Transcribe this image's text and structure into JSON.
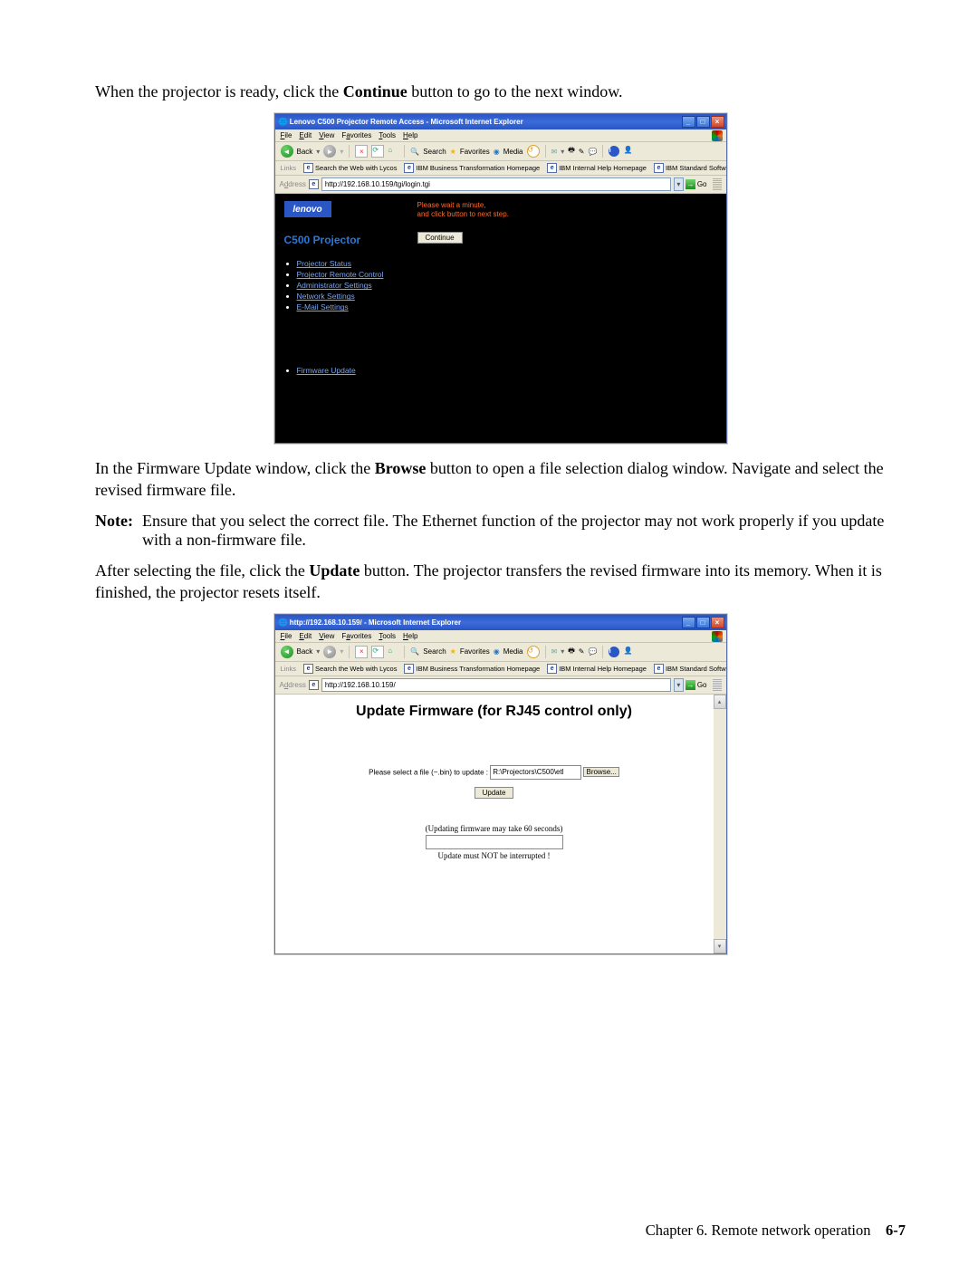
{
  "doc": {
    "para1_pre": "When the projector is ready, click the ",
    "para1_bold": "Continue",
    "para1_post": " button to go to the next window.",
    "para2_pre": "In the Firmware Update window, click the ",
    "para2_bold": "Browse",
    "para2_post": " button to open a file selection dialog window. Navigate and select the revised firmware file.",
    "note_label": "Note:",
    "note_body": "Ensure that you select the correct file. The Ethernet function of the projector may not work properly if you update with a non-firmware file.",
    "para3_pre": "After selecting the file, click the ",
    "para3_bold": "Update",
    "para3_post": " button. The projector transfers the revised firmware into its memory. When it is finished, the projector resets itself."
  },
  "win1": {
    "title": "Lenovo C500 Projector Remote Access - Microsoft Internet Explorer",
    "address": "http://192.168.10.159/tgi/login.tgi",
    "sidebar_title": "C500 Projector",
    "logo_text": "lenovo",
    "wait_msg1": "Please wait a minute,",
    "wait_msg2": "and click button to next step.",
    "continue_btn": "Continue",
    "nav": {
      "status": "Projector Status",
      "remote": "Projector Remote Control",
      "admin": "Administrator Settings",
      "network": "Network Settings",
      "email": "E-Mail Settings",
      "firmware": "Firmware Update"
    }
  },
  "win2": {
    "title": "http://192.168.10.159/ - Microsoft Internet Explorer",
    "address": "http://192.168.10.159/",
    "page_title": "Update Firmware (for RJ45 control only)",
    "prompt": "Please select a file (~.bin) to update :",
    "path_value": "R:\\Projectors\\C500\\etl",
    "browse_btn": "Browse...",
    "update_btn": "Update",
    "progress_caption": "(Updating firmware may take 60 seconds)",
    "warn": "Update  must  NOT  be  interrupted  !"
  },
  "ie": {
    "menu": {
      "file": "File",
      "edit": "Edit",
      "view": "View",
      "favorites": "Favorites",
      "tools": "Tools",
      "help": "Help"
    },
    "toolbar": {
      "back": "Back",
      "search": "Search",
      "favorites": "Favorites",
      "media": "Media",
      "go": "Go"
    },
    "links_label": "Links",
    "address_label": "Address",
    "links": {
      "lycos": "Search the Web with Lycos",
      "biztrans": "IBM Business Transformation Homepage",
      "help": "IBM Internal Help Homepage",
      "installer": "IBM Standard Software Installer"
    }
  },
  "footer": {
    "chapter": "Chapter 6. Remote network operation",
    "page": "6-7"
  }
}
